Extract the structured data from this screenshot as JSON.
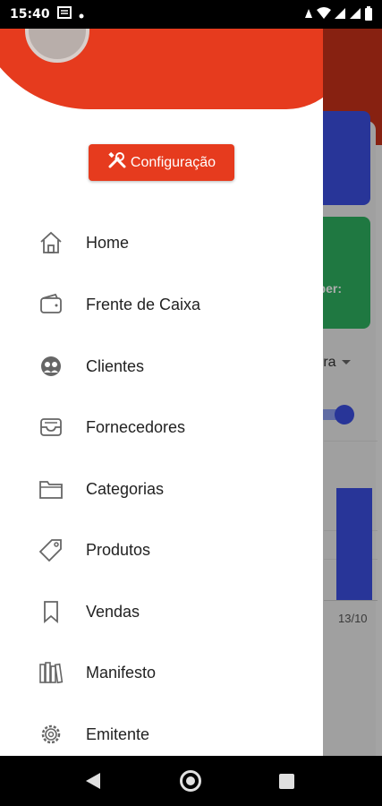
{
  "status_bar": {
    "time": "15:40"
  },
  "background": {
    "card_green_text": "ber:",
    "select_text": "rra",
    "chart_label": "13/10"
  },
  "drawer": {
    "config_button": "Configuração",
    "menu": [
      {
        "label": "Home",
        "icon": "home-icon"
      },
      {
        "label": "Frente de Caixa",
        "icon": "wallet-icon"
      },
      {
        "label": "Clientes",
        "icon": "clients-icon"
      },
      {
        "label": "Fornecedores",
        "icon": "inbox-icon"
      },
      {
        "label": "Categorias",
        "icon": "folder-icon"
      },
      {
        "label": "Produtos",
        "icon": "tag-icon"
      },
      {
        "label": "Vendas",
        "icon": "bookmark-icon"
      },
      {
        "label": "Manifesto",
        "icon": "books-icon"
      },
      {
        "label": "Emitente",
        "icon": "gear-icon"
      }
    ]
  },
  "colors": {
    "accent": "#e63b1e",
    "header_dark": "#c7321a",
    "blue": "#3b4fe0",
    "green": "#2fb160"
  }
}
